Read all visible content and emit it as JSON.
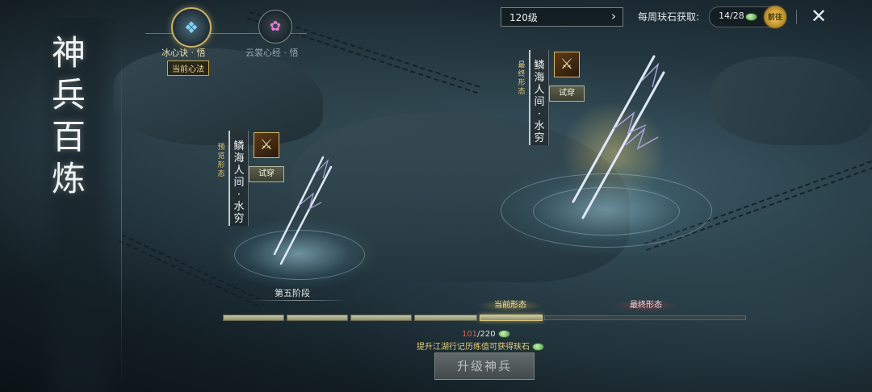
{
  "title": [
    "神",
    "兵",
    "百",
    "炼"
  ],
  "methods": [
    {
      "label": "冰心诀 · 悟",
      "icon": "ice-heart-icon",
      "selected": true
    },
    {
      "label": "云裳心经 · 悟",
      "icon": "lotus-icon",
      "selected": false
    }
  ],
  "current_method_badge": "当前心法",
  "level": {
    "value": "120级"
  },
  "weekly": {
    "label": "每周玞石获取:",
    "count": "14/28",
    "go_label": "前往"
  },
  "preview": {
    "tag": [
      "预",
      "览",
      "形",
      "态"
    ],
    "name": [
      "鳞",
      "海",
      "人",
      "间",
      "·",
      "水",
      "穷"
    ],
    "try_label": "试穿"
  },
  "final": {
    "tag": [
      "最",
      "终",
      "形",
      "态"
    ],
    "name": [
      "鳞",
      "海",
      "人",
      "间",
      "·",
      "水",
      "穷"
    ],
    "try_label": "试穿"
  },
  "stage_label": "第五阶段",
  "progress_tags": {
    "current": "当前形态",
    "final": "最终形态"
  },
  "segments_filled": 5,
  "progress": {
    "current": "101",
    "total": "/220"
  },
  "hint": "提升江湖行记历练值可获得玞石",
  "upgrade_button": "升级神兵",
  "colors": {
    "gold": "#c9b06a",
    "progress_red": "#e35a4d",
    "gem_green": "#4f9a55"
  }
}
